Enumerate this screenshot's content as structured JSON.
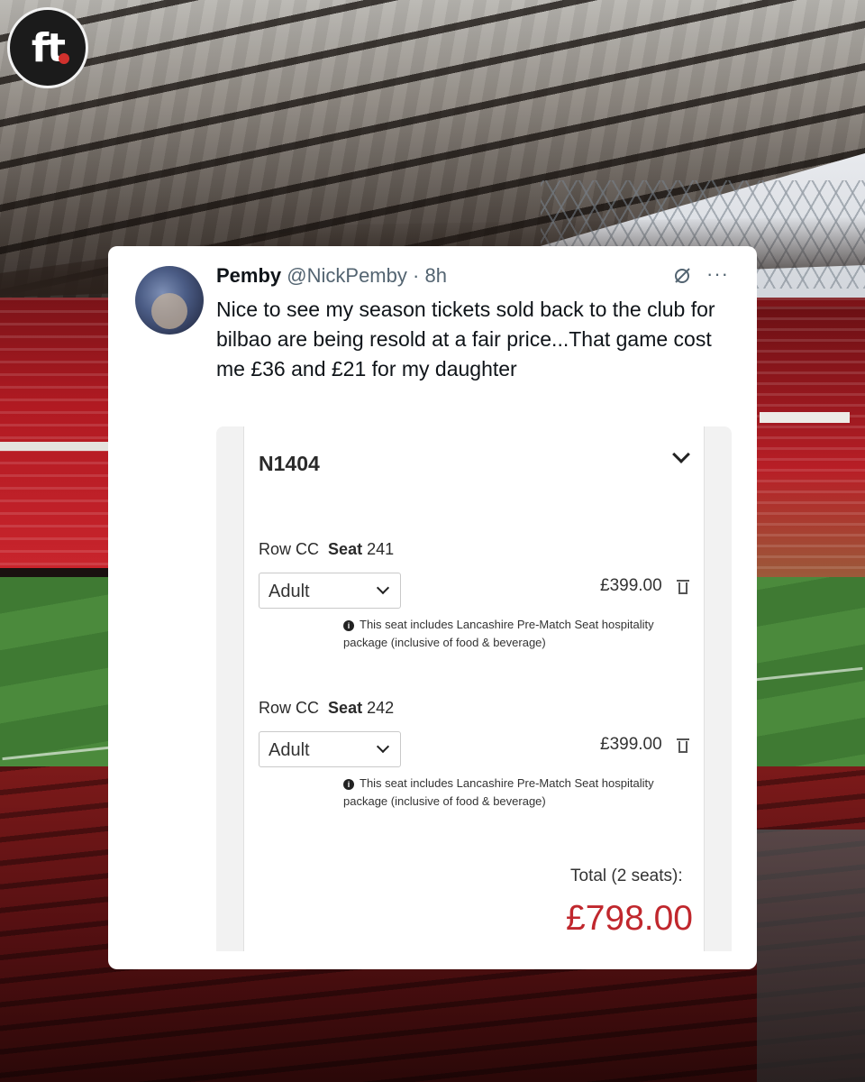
{
  "logo": {
    "text": "ft"
  },
  "tweet": {
    "name": "Pemby",
    "handle": "@NickPemby",
    "separator": "·",
    "time": "8h",
    "grok_icon": "grok-icon",
    "more_icon": "···",
    "text": "Nice to see my season tickets sold back to the club for bilbao are being resold at a fair price...That game cost me £36 and £21 for my daughter"
  },
  "ticket": {
    "section": "N1404",
    "seats": [
      {
        "row_label": "Row",
        "row": "CC",
        "seat_label": "Seat",
        "seat": "241",
        "type": "Adult",
        "price": "£399.00",
        "note_icon": "info-icon",
        "note": "This seat includes Lancashire Pre-Match Seat hospitality package (inclusive of food & beverage)"
      },
      {
        "row_label": "Row",
        "row": "CC",
        "seat_label": "Seat",
        "seat": "242",
        "type": "Adult",
        "price": "£399.00",
        "note_icon": "info-icon",
        "note": "This seat includes Lancashire Pre-Match Seat hospitality package (inclusive of food & beverage)"
      }
    ],
    "total_label": "Total  (2 seats):",
    "total": "£798.00",
    "total_color": "#c0272d"
  }
}
